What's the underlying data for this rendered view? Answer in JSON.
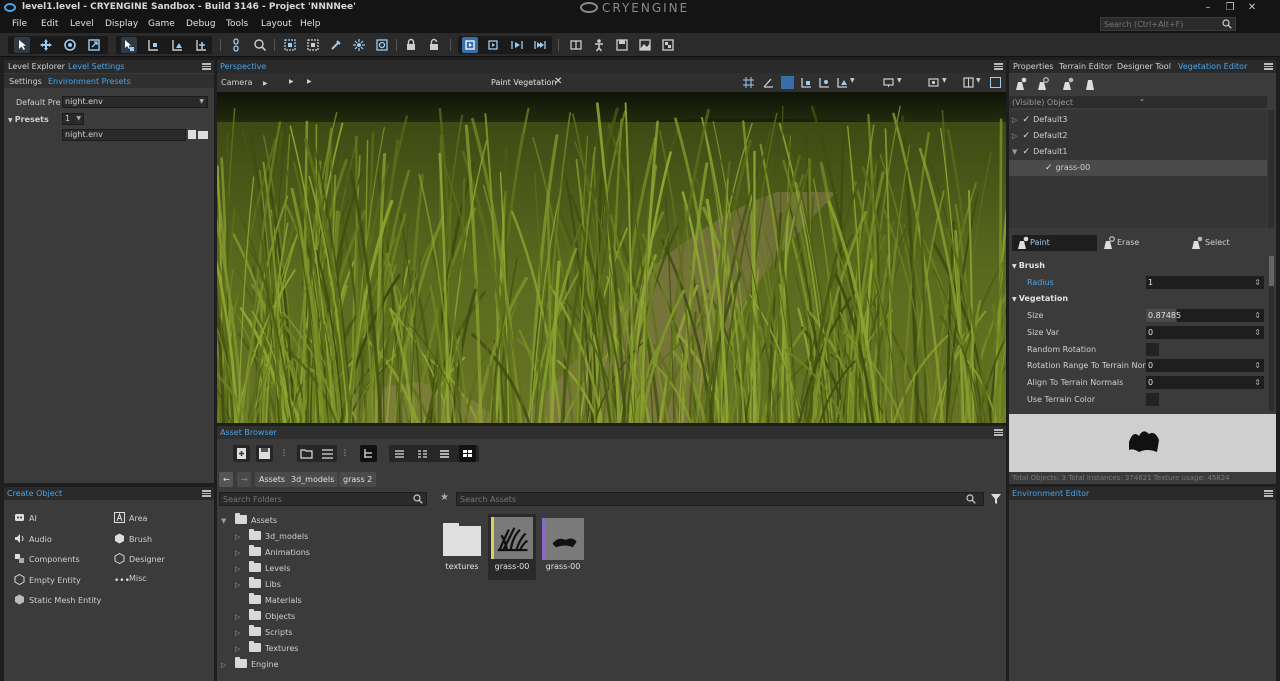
{
  "window": {
    "title": "level1.level - CRYENGINE Sandbox - Build 3146 - Project 'NNNNee'",
    "brand": "CRYENGINE"
  },
  "menu": {
    "items": [
      "File",
      "Edit",
      "Level",
      "Display",
      "Game",
      "Debug",
      "Tools",
      "Layout",
      "Help"
    ],
    "search_placeholder": "Search (Ctrl+Alt+F)"
  },
  "level_panel": {
    "tabs": [
      "Level Explorer",
      "Level Settings"
    ],
    "subtabs": [
      "Settings",
      "Environment Presets"
    ],
    "default_preset_label": "Default Pre",
    "default_preset_value": "night.env",
    "presets_label": "Presets",
    "presets_count": "1",
    "preset_item": "night.env"
  },
  "create_object": {
    "title": "Create Object",
    "items": [
      "AI",
      "Area",
      "Audio",
      "Brush",
      "Components",
      "Designer",
      "Empty Entity",
      "Misc",
      "Static Mesh Entity"
    ]
  },
  "viewport": {
    "title": "Perspective",
    "camera_label": "Camera",
    "mode_label": "Paint Vegetation"
  },
  "asset_browser": {
    "title": "Asset Browser",
    "breadcrumbs": [
      "Assets",
      "3d_models",
      "grass 2"
    ],
    "search_folders_placeholder": "Search Folders",
    "search_assets_placeholder": "Search Assets",
    "tree": [
      {
        "label": "Assets",
        "expanded": true
      },
      {
        "label": "3d_models"
      },
      {
        "label": "Animations"
      },
      {
        "label": "Levels"
      },
      {
        "label": "Libs"
      },
      {
        "label": "Materials"
      },
      {
        "label": "Objects"
      },
      {
        "label": "Scripts"
      },
      {
        "label": "Textures"
      },
      {
        "label": "Engine"
      }
    ],
    "assets": [
      "textures",
      "grass-00",
      "grass-00"
    ]
  },
  "vegetation": {
    "tabs": [
      "Properties",
      "Terrain Editor",
      "Designer Tool",
      "Vegetation Editor"
    ],
    "object_header": "(Visible) Object",
    "groups": [
      {
        "label": "Default3",
        "checked": true
      },
      {
        "label": "Default2",
        "checked": true
      },
      {
        "label": "Default1",
        "checked": true
      },
      {
        "label": "grass-00",
        "checked": true
      }
    ],
    "tools": {
      "paint": "Paint",
      "erase": "Erase",
      "select": "Select"
    },
    "brush_section": "Brush",
    "radius_label": "Radius",
    "radius_value": "1",
    "vegetation_section": "Vegetation",
    "size_label": "Size",
    "size_value": "0.87485",
    "size_var_label": "Size Var",
    "size_var_value": "0",
    "random_rotation_label": "Random Rotation",
    "rotation_range_label": "Rotation Range To Terrain Nor",
    "rotation_range_value": "0",
    "align_label": "Align To Terrain Normals",
    "align_value": "0",
    "use_terrain_color_label": "Use Terrain Color",
    "status": "Total Objects: 3  Total Instances: 374621  Texture usage: 45824"
  },
  "environment_editor": {
    "title": "Environment Editor"
  },
  "colors": {
    "accent": "#4aa3e8",
    "panel": "#3b3b3b",
    "header": "#2a2a2a"
  }
}
